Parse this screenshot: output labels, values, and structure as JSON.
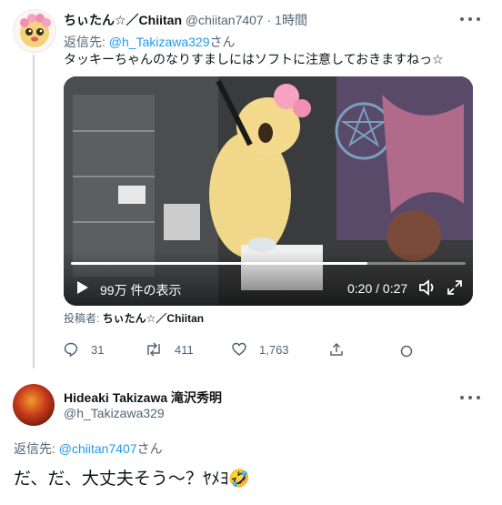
{
  "tweet1": {
    "display_name": "ちぃたん☆／Chiitan",
    "handle": "@chiitan7407",
    "separator": "·",
    "time": "1時間",
    "reply_to_label": "返信先: ",
    "reply_to_handle": "@h_Takizawa329",
    "reply_to_suffix": "さん",
    "text": "タッキーちゃんのなりすましにはソフトに注意しておきますねっ☆",
    "video": {
      "views": "99万 件の表示",
      "time": "0:20 / 0:27",
      "progress": 0.75
    },
    "poster_label": "投稿者: ",
    "poster_name": "ちぃたん☆／Chiitan",
    "replies": "31",
    "retweets": "411",
    "likes": "1,763"
  },
  "tweet2": {
    "display_name": "Hideaki Takizawa 滝沢秀明",
    "handle": "@h_Takizawa329",
    "reply_to_label": "返信先: ",
    "reply_to_handle": "@chiitan7407",
    "reply_to_suffix": "さん",
    "text": "だ、だ、大丈夫そう～？ﾔﾒﾖ🤣"
  },
  "icons": [
    "more-icon",
    "play-icon",
    "volume-icon",
    "fullscreen-icon",
    "reply-icon",
    "retweet-icon",
    "like-icon",
    "share-icon",
    "analytics-icon"
  ],
  "colors": {
    "accent": "#1d9bf0",
    "muted": "#536471",
    "line": "#cfd9de"
  }
}
